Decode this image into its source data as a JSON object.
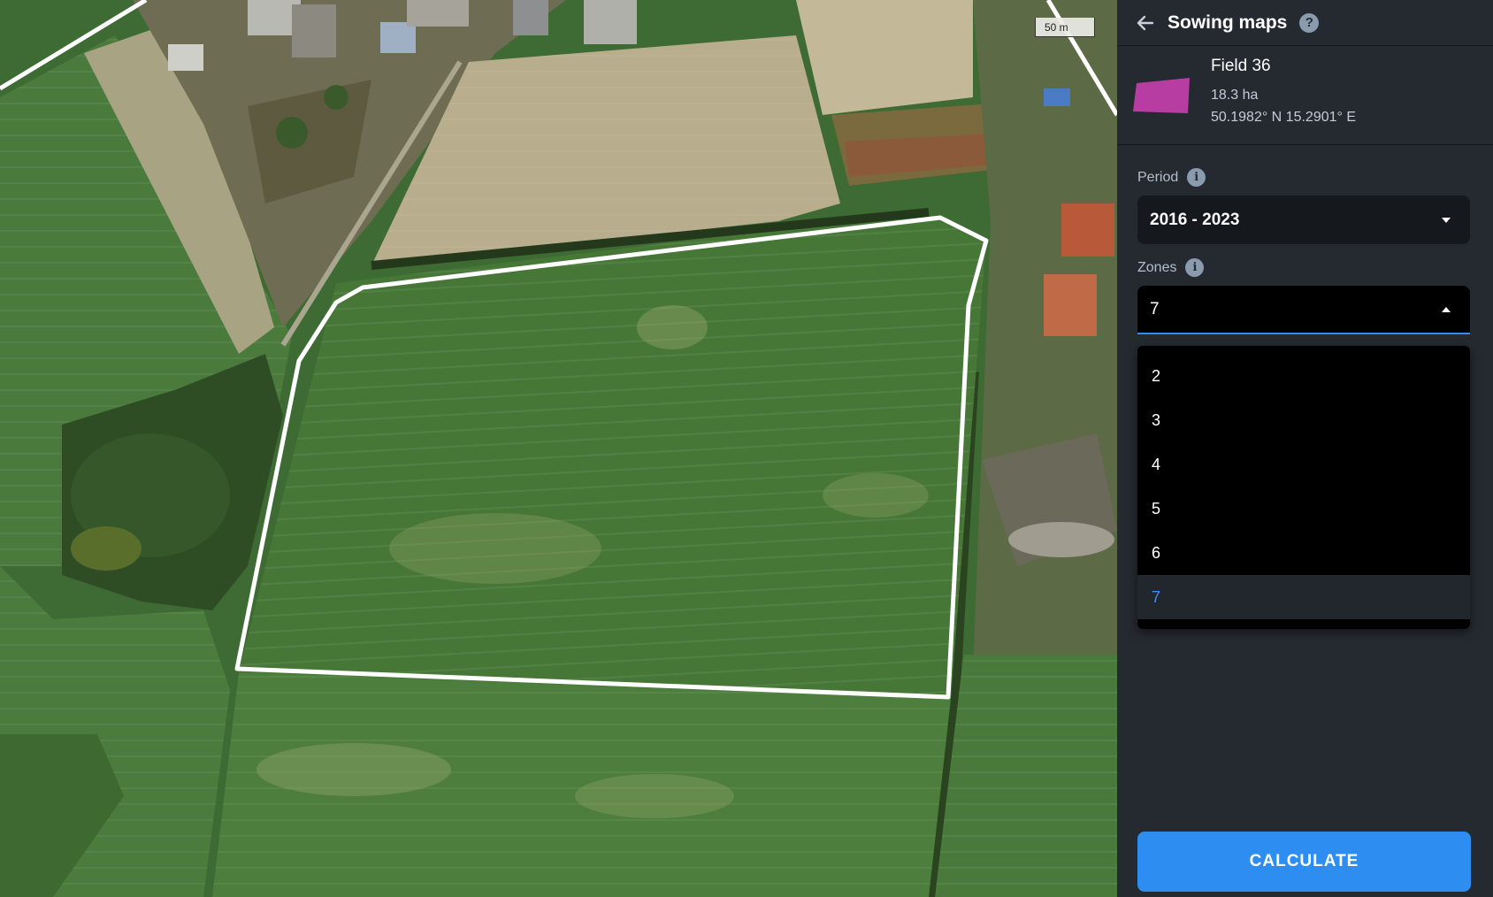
{
  "map": {
    "scale_label": "50 m"
  },
  "panel": {
    "title": "Sowing maps",
    "back_icon": "arrow-left-icon",
    "help_icon": "question-mark-icon",
    "help_glyph": "?"
  },
  "field": {
    "name": "Field 36",
    "area": "18.3 ha",
    "coordinates": "50.1982° N 15.2901° E",
    "shape_color": "#b83da3"
  },
  "period": {
    "label": "Period",
    "info_icon": "info-icon",
    "info_glyph": "i",
    "value": "2016 - 2023"
  },
  "zones": {
    "label": "Zones",
    "info_icon": "info-icon",
    "info_glyph": "i",
    "value": "7",
    "options": [
      "2",
      "3",
      "4",
      "5",
      "6",
      "7"
    ],
    "selected": "7"
  },
  "actions": {
    "calculate_label": "CALCULATE"
  },
  "colors": {
    "accent": "#2d8df0",
    "panel_bg": "#252a31",
    "field_boundary": "#ffffff"
  }
}
